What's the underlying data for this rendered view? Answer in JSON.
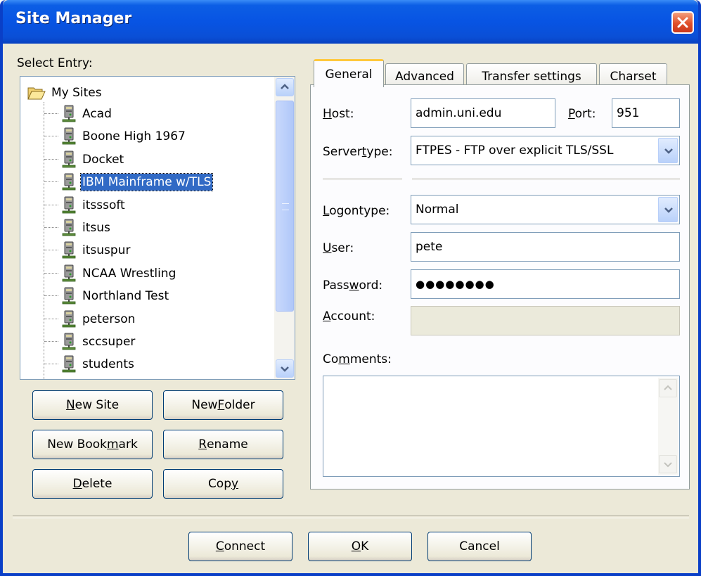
{
  "window": {
    "title": "Site Manager"
  },
  "select_entry": {
    "label": "Select Entry:"
  },
  "tree": {
    "root": "My Sites",
    "items": [
      {
        "label": "Acad"
      },
      {
        "label": "Boone High 1967"
      },
      {
        "label": "Docket"
      },
      {
        "label": "IBM Mainframe w/TLS",
        "selected": true
      },
      {
        "label": "itsssoft"
      },
      {
        "label": "itsus"
      },
      {
        "label": "itsuspur"
      },
      {
        "label": "NCAA Wrestling"
      },
      {
        "label": "Northland Test"
      },
      {
        "label": "peterson"
      },
      {
        "label": "sccsuper"
      },
      {
        "label": "students"
      }
    ]
  },
  "buttons": {
    "new_site": {
      "pre": "",
      "u": "N",
      "post": "ew Site"
    },
    "new_folder": {
      "pre": "New ",
      "u": "F",
      "post": "older"
    },
    "new_bookmark": {
      "pre": "New Book",
      "u": "m",
      "post": "ark"
    },
    "rename": {
      "pre": "",
      "u": "R",
      "post": "ename"
    },
    "delete": {
      "pre": "",
      "u": "D",
      "post": "elete"
    },
    "copy": {
      "pre": "Cop",
      "u": "y",
      "post": ""
    },
    "connect": {
      "pre": "",
      "u": "C",
      "post": "onnect"
    },
    "ok": {
      "pre": "",
      "u": "O",
      "post": "K"
    },
    "cancel": "Cancel"
  },
  "tabs": [
    "General",
    "Advanced",
    "Transfer settings",
    "Charset"
  ],
  "form": {
    "host": {
      "pre": "",
      "u": "H",
      "post": "ost:",
      "value": "admin.uni.edu"
    },
    "port": {
      "pre": "",
      "u": "P",
      "post": "ort:",
      "value": "951"
    },
    "servertype": {
      "pre": "Server",
      "u": "t",
      "post": "ype:",
      "value": "FTPES - FTP over explicit TLS/SSL"
    },
    "logontype": {
      "pre": "",
      "u": "L",
      "post": "ogontype:",
      "value": "Normal"
    },
    "user": {
      "pre": "",
      "u": "U",
      "post": "ser:",
      "value": "pete"
    },
    "password": {
      "pre": "Pass",
      "u": "w",
      "post": "ord:",
      "value": "●●●●●●●●"
    },
    "account": {
      "pre": "",
      "u": "A",
      "post": "ccount:",
      "value": ""
    },
    "comments": {
      "pre": "Co",
      "u": "m",
      "post": "ments:",
      "value": ""
    }
  },
  "colors": {
    "titlebar": "#0854e3",
    "selection": "#316ac5",
    "dialog_bg": "#ece9d8",
    "tab_highlight": "#ffc83c"
  }
}
